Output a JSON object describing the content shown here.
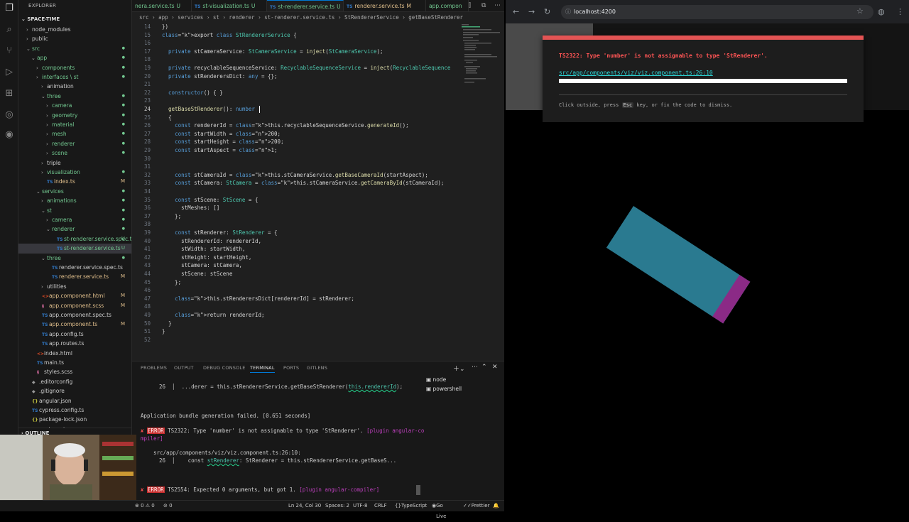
{
  "explorer": {
    "title": "EXPLORER",
    "workspace": "SPACE-TIME",
    "outline": "OUTLINE",
    "tree": [
      {
        "label": "node_modules",
        "depth": 1,
        "chev": "›",
        "kind": "folder",
        "badge": ""
      },
      {
        "label": "public",
        "depth": 1,
        "chev": "›",
        "kind": "folder",
        "badge": ""
      },
      {
        "label": "src",
        "depth": 1,
        "chev": "⌄",
        "kind": "folder",
        "badge": "●"
      },
      {
        "label": "app",
        "depth": 2,
        "chev": "⌄",
        "kind": "folder",
        "badge": "●"
      },
      {
        "label": "components",
        "depth": 3,
        "chev": "›",
        "kind": "folder",
        "badge": "●"
      },
      {
        "label": "interfaces \\ st",
        "depth": 3,
        "chev": "›",
        "kind": "folder",
        "badge": "●"
      },
      {
        "label": "animation",
        "depth": 4,
        "chev": "›",
        "kind": "folder",
        "badge": ""
      },
      {
        "label": "three",
        "depth": 4,
        "chev": "⌄",
        "kind": "folder",
        "badge": "●"
      },
      {
        "label": "camera",
        "depth": 5,
        "chev": "›",
        "kind": "folder",
        "badge": "●"
      },
      {
        "label": "geometry",
        "depth": 5,
        "chev": "›",
        "kind": "folder",
        "badge": "●"
      },
      {
        "label": "material",
        "depth": 5,
        "chev": "›",
        "kind": "folder",
        "badge": "●"
      },
      {
        "label": "mesh",
        "depth": 5,
        "chev": "›",
        "kind": "folder",
        "badge": "●"
      },
      {
        "label": "renderer",
        "depth": 5,
        "chev": "›",
        "kind": "folder",
        "badge": "●"
      },
      {
        "label": "scene",
        "depth": 5,
        "chev": "›",
        "kind": "folder",
        "badge": "●"
      },
      {
        "label": "triple",
        "depth": 4,
        "chev": "›",
        "kind": "folder",
        "badge": ""
      },
      {
        "label": "visualization",
        "depth": 4,
        "chev": "›",
        "kind": "folder",
        "badge": "●"
      },
      {
        "label": "index.ts",
        "depth": 4,
        "chev": "",
        "kind": "ts",
        "badge": "M"
      },
      {
        "label": "services",
        "depth": 3,
        "chev": "⌄",
        "kind": "folder",
        "badge": "●"
      },
      {
        "label": "animations",
        "depth": 4,
        "chev": "›",
        "kind": "folder",
        "badge": "●"
      },
      {
        "label": "st",
        "depth": 4,
        "chev": "⌄",
        "kind": "folder",
        "badge": "●"
      },
      {
        "label": "camera",
        "depth": 5,
        "chev": "›",
        "kind": "folder",
        "badge": "●"
      },
      {
        "label": "renderer",
        "depth": 5,
        "chev": "⌄",
        "kind": "folder",
        "badge": "●"
      },
      {
        "label": "st-renderer.service.spec.ts",
        "depth": 6,
        "chev": "",
        "kind": "ts",
        "badge": "U"
      },
      {
        "label": "st-renderer.service.ts",
        "depth": 6,
        "chev": "",
        "kind": "ts",
        "badge": "U",
        "selected": true
      },
      {
        "label": "three",
        "depth": 4,
        "chev": "⌄",
        "kind": "folder",
        "badge": "●"
      },
      {
        "label": "renderer.service.spec.ts",
        "depth": 5,
        "chev": "",
        "kind": "ts",
        "badge": ""
      },
      {
        "label": "renderer.service.ts",
        "depth": 5,
        "chev": "",
        "kind": "ts",
        "badge": "M"
      },
      {
        "label": "utilities",
        "depth": 4,
        "chev": "›",
        "kind": "folder",
        "badge": ""
      },
      {
        "label": "app.component.html",
        "depth": 3,
        "chev": "",
        "kind": "html",
        "badge": "M"
      },
      {
        "label": "app.component.scss",
        "depth": 3,
        "chev": "",
        "kind": "scss",
        "badge": "M"
      },
      {
        "label": "app.component.spec.ts",
        "depth": 3,
        "chev": "",
        "kind": "ts",
        "badge": ""
      },
      {
        "label": "app.component.ts",
        "depth": 3,
        "chev": "",
        "kind": "ts",
        "badge": "M"
      },
      {
        "label": "app.config.ts",
        "depth": 3,
        "chev": "",
        "kind": "ts",
        "badge": ""
      },
      {
        "label": "app.routes.ts",
        "depth": 3,
        "chev": "",
        "kind": "ts",
        "badge": ""
      },
      {
        "label": "index.html",
        "depth": 2,
        "chev": "",
        "kind": "html",
        "badge": ""
      },
      {
        "label": "main.ts",
        "depth": 2,
        "chev": "",
        "kind": "ts",
        "badge": ""
      },
      {
        "label": "styles.scss",
        "depth": 2,
        "chev": "",
        "kind": "scss",
        "badge": ""
      },
      {
        "label": ".editorconfig",
        "depth": 1,
        "chev": "",
        "kind": "cfg",
        "badge": ""
      },
      {
        "label": ".gitignore",
        "depth": 1,
        "chev": "",
        "kind": "cfg",
        "badge": ""
      },
      {
        "label": "angular.json",
        "depth": 1,
        "chev": "",
        "kind": "json",
        "badge": ""
      },
      {
        "label": "cypress.config.ts",
        "depth": 1,
        "chev": "",
        "kind": "ts",
        "badge": ""
      },
      {
        "label": "package-lock.json",
        "depth": 1,
        "chev": "",
        "kind": "json",
        "badge": ""
      },
      {
        "label": "package.json",
        "depth": 1,
        "chev": "",
        "kind": "json",
        "badge": ""
      }
    ]
  },
  "tabs": [
    {
      "label": "nera.service.ts",
      "badge": "U",
      "ts": false
    },
    {
      "label": "st-visualization.ts",
      "badge": "U",
      "ts": true
    },
    {
      "label": "st-renderer.service.ts",
      "badge": "U",
      "ts": true,
      "active": true
    },
    {
      "label": "renderer.service.ts",
      "badge": "M",
      "ts": true
    },
    {
      "label": "app.compon",
      "badge": "",
      "ts": false
    }
  ],
  "breadcrumb": "src › app › services › st › renderer › st-renderer.service.ts › StRendererService › getBaseStRenderer",
  "editor": {
    "lines": [
      {
        "n": "14",
        "code": "})"
      },
      {
        "n": "15",
        "code": "export class StRendererService {"
      },
      {
        "n": "16",
        "code": ""
      },
      {
        "n": "17",
        "code": "  private stCameraService: StCameraService = inject(StCameraService);"
      },
      {
        "n": "18",
        "code": ""
      },
      {
        "n": "19",
        "code": "  private recyclableSequenceService: RecyclableSequenceService = inject(RecyclableSequence"
      },
      {
        "n": "20",
        "code": "  private stRenderersDict: any = {};"
      },
      {
        "n": "21",
        "code": ""
      },
      {
        "n": "22",
        "code": "  constructor() { }"
      },
      {
        "n": "23",
        "code": ""
      },
      {
        "n": "24",
        "code": "  getBaseStRenderer(): number"
      },
      {
        "n": "25",
        "code": "  {"
      },
      {
        "n": "26",
        "code": "    const rendererId = this.recyclableSequenceService.generateId();"
      },
      {
        "n": "27",
        "code": "    const startWidth = 200;"
      },
      {
        "n": "28",
        "code": "    const startHeight = 200;"
      },
      {
        "n": "29",
        "code": "    const startAspect = 1;"
      },
      {
        "n": "30",
        "code": ""
      },
      {
        "n": "31",
        "code": ""
      },
      {
        "n": "32",
        "code": "    const stCameraId = this.stCameraService.getBaseCameraId(startAspect);"
      },
      {
        "n": "33",
        "code": "    const stCamera: StCamera = this.stCameraService.getCameraById(stCameraId);"
      },
      {
        "n": "34",
        "code": ""
      },
      {
        "n": "35",
        "code": "    const stScene: StScene = {"
      },
      {
        "n": "36",
        "code": "      stMeshes: []"
      },
      {
        "n": "37",
        "code": "    };"
      },
      {
        "n": "38",
        "code": ""
      },
      {
        "n": "39",
        "code": "    const stRenderer: StRenderer = {"
      },
      {
        "n": "40",
        "code": "      stRendererId: rendererId,"
      },
      {
        "n": "41",
        "code": "      stWidth: startWidth,"
      },
      {
        "n": "42",
        "code": "      stHeight: startHeight,"
      },
      {
        "n": "43",
        "code": "      stCamera: stCamera,"
      },
      {
        "n": "44",
        "code": "      stScene: stScene"
      },
      {
        "n": "45",
        "code": "    };"
      },
      {
        "n": "46",
        "code": ""
      },
      {
        "n": "47",
        "code": "    this.stRenderersDict[rendererId] = stRenderer;"
      },
      {
        "n": "48",
        "code": ""
      },
      {
        "n": "49",
        "code": "    return rendererId;"
      },
      {
        "n": "50",
        "code": "  }"
      },
      {
        "n": "51",
        "code": "}"
      },
      {
        "n": "52",
        "code": ""
      }
    ]
  },
  "panel": {
    "tabs": [
      "PROBLEMS",
      "OUTPUT",
      "DEBUG CONSOLE",
      "TERMINAL",
      "PORTS",
      "GITLENS"
    ],
    "active_tab": "TERMINAL",
    "terminals": [
      "node",
      "powershell"
    ],
    "lines": {
      "l1_num": "26",
      "l1_text": "...derer = this.stRendererService.getBaseStRenderer(",
      "l1_arg": "this.rendererId",
      "l1_end": ");",
      "bundle": "Application bundle generation failed. [0.651 seconds]",
      "err1_tag": "ERROR",
      "err1_msg": "TS2322: Type 'number' is not assignable to type 'StRenderer'.",
      "err1_plugin": "[plugin angular-co",
      "err1_plugin2": "mpiler]",
      "err1_file": "src/app/components/viz/viz.component.ts:26:10:",
      "err1_num": "26",
      "err1_code_a": "const ",
      "err1_code_b": "stRenderer",
      "err1_code_c": ": StRenderer = this.stRendererService.getBaseS...",
      "err2_tag": "ERROR",
      "err2_msg": "TS2554: Expected 0 arguments, but got 1.",
      "err2_plugin": "[plugin angular-compiler]"
    }
  },
  "status": {
    "problems": "⊗ 0 ⚠ 0",
    "ports": "⊘ 0",
    "position": "Ln 24, Col 30",
    "spaces": "Spaces: 2",
    "encoding": "UTF-8",
    "eol": "CRLF",
    "language": "TypeScript",
    "golive": "Go Live",
    "prettier": "Prettier"
  },
  "browser": {
    "url": "localhost:4200",
    "error_message": "TS2322: Type 'number' is not assignable to type 'StRenderer'.",
    "error_file": "src/app/components/viz/viz.component.ts:26:10",
    "tip_a": "Click outside, press",
    "tip_key": "Esc",
    "tip_b": "key, or fix the code to dismiss."
  },
  "colors": {
    "accent": "#0078d4",
    "error_red": "#e45454",
    "cube_body": "#2a7a90",
    "cube_face": "#8b2a86"
  }
}
